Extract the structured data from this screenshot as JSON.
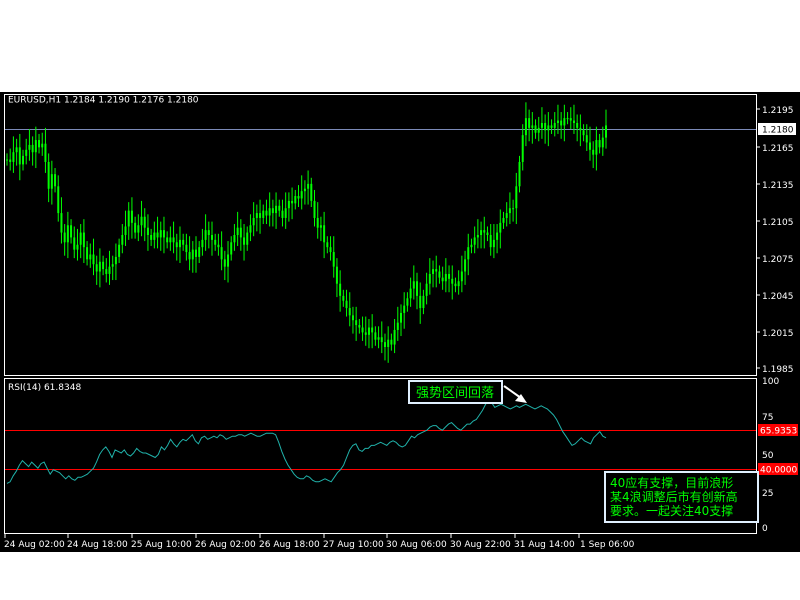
{
  "colors": {
    "background": "#000000",
    "candle": "#00ff00",
    "rsi_line": "#20b2aa",
    "level_line": "#ff0000",
    "price_line": "#7b8ab8",
    "text": "#ffffff",
    "note_text": "#00ff00",
    "note_border": "#e0f0ff"
  },
  "price_panel": {
    "header": "EURUSD,H1  1.2184 1.2190 1.2176 1.2180",
    "current_price": "1.2180",
    "y_ticks": [
      "1.2195",
      "1.2165",
      "1.2135",
      "1.2105",
      "1.2075",
      "1.2045",
      "1.2015",
      "1.1985"
    ]
  },
  "rsi_panel": {
    "header": "RSI(14)  61.8348",
    "y_ticks": [
      "100",
      "75",
      "50",
      "25",
      "0"
    ],
    "level_high": "65.9353",
    "level_low": "40.0000"
  },
  "x_axis": {
    "labels": [
      "24 Aug 02:00",
      "24 Aug 18:00",
      "25 Aug 10:00",
      "26 Aug 02:00",
      "26 Aug 18:00",
      "27 Aug 10:00",
      "30 Aug 06:00",
      "30 Aug 22:00",
      "31 Aug 14:00",
      "1 Sep 06:00"
    ]
  },
  "annotations": {
    "strong_zone": "强势区间回落",
    "note_line1": "40应有支撑，目前浪形",
    "note_line2": "某4浪调整后市有创新高",
    "note_line3": "要求。一起关注40支撑"
  },
  "chart_data": {
    "type": "line",
    "price_range": [
      1.1975,
      1.2205
    ],
    "close": [
      1.2152,
      1.215,
      1.2158,
      1.2162,
      1.2148,
      1.2155,
      1.216,
      1.2164,
      1.2158,
      1.2168,
      1.2162,
      1.2165,
      1.215,
      1.2128,
      1.214,
      1.213,
      1.2108,
      1.2092,
      1.2084,
      1.2098,
      1.2088,
      1.2078,
      1.2082,
      1.2092,
      1.208,
      1.207,
      1.2074,
      1.2066,
      1.206,
      1.2068,
      1.2062,
      1.2058,
      1.2064,
      1.2066,
      1.2072,
      1.2082,
      1.209,
      1.2097,
      1.211,
      1.21,
      1.2092,
      1.2098,
      1.2105,
      1.2096,
      1.209,
      1.2086,
      1.2092,
      1.2088,
      1.2094,
      1.2088,
      1.2084,
      1.2088,
      1.2084,
      1.208,
      1.2086,
      1.2082,
      1.2076,
      1.207,
      1.2078,
      1.2072,
      1.208,
      1.2086,
      1.2094,
      1.209,
      1.2086,
      1.2082,
      1.208,
      1.207,
      1.2064,
      1.2074,
      1.2084,
      1.209,
      1.2096,
      1.2088,
      1.2082,
      1.2092,
      1.2098,
      1.2104,
      1.2108,
      1.2104,
      1.211,
      1.2106,
      1.2112,
      1.2108,
      1.2114,
      1.211,
      1.2104,
      1.2112,
      1.2118,
      1.2116,
      1.2122,
      1.212,
      1.2126,
      1.2128,
      1.2132,
      1.2118,
      1.2104,
      1.2096,
      1.2098,
      1.2084,
      1.208,
      1.2076,
      1.2064,
      1.205,
      1.204,
      1.2036,
      1.203,
      1.2024,
      1.202,
      1.2016,
      1.2014,
      1.201,
      1.2008,
      1.2014,
      1.201,
      1.2004,
      1.2006,
      1.2002,
      1.1998,
      1.2004,
      1.2,
      1.2012,
      1.2018,
      1.2026,
      1.2032,
      1.2038,
      1.2046,
      1.2052,
      1.204,
      1.203,
      1.204,
      1.205,
      1.2058,
      1.2062,
      1.206,
      1.2055,
      1.2052,
      1.2058,
      1.2054,
      1.205,
      1.2048,
      1.2052,
      1.206,
      1.207,
      1.208,
      1.2082,
      1.2088,
      1.209,
      1.2094,
      1.2092,
      1.209,
      1.208,
      1.2086,
      1.2092,
      1.21,
      1.2104,
      1.2108,
      1.2112,
      1.2112,
      1.213,
      1.215,
      1.2172,
      1.2186,
      1.2178,
      1.218,
      1.2174,
      1.2178,
      1.2182,
      1.2176,
      1.218,
      1.2178,
      1.2182,
      1.2184,
      1.218,
      1.2186,
      1.2186,
      1.2184,
      1.2182,
      1.2178,
      1.2176,
      1.2172,
      1.2166,
      1.216,
      1.2156,
      1.2168,
      1.2162,
      1.217,
      1.218
    ],
    "rsi": [
      32,
      33,
      37,
      40,
      44,
      47,
      45,
      43,
      46,
      44,
      42,
      45,
      46,
      42,
      38,
      41,
      40,
      39,
      37,
      35,
      37,
      35,
      34,
      36,
      36,
      37,
      38,
      40,
      42,
      46,
      51,
      54,
      56,
      53,
      49,
      54,
      53,
      52,
      54,
      51,
      50,
      52,
      55,
      53,
      52,
      52,
      51,
      50,
      49,
      51,
      56,
      54,
      57,
      61,
      58,
      56,
      59,
      61,
      60,
      62,
      64,
      60,
      58,
      62,
      63,
      61,
      62,
      63,
      62,
      64,
      63,
      61,
      62,
      63,
      63,
      64,
      64,
      63,
      64,
      65,
      64,
      63,
      63,
      64,
      65,
      65,
      65,
      64,
      59,
      53,
      48,
      44,
      41,
      38,
      36,
      35,
      35,
      37,
      36,
      34,
      33,
      33,
      34,
      35,
      34,
      33,
      36,
      39,
      41,
      44,
      49,
      54,
      57,
      58,
      54,
      53,
      55,
      55,
      57,
      57,
      58,
      59,
      58,
      57,
      59,
      60,
      59,
      57,
      56,
      57,
      60,
      63,
      62,
      64,
      65,
      66,
      67,
      69,
      70,
      70,
      68,
      67,
      69,
      71,
      72,
      70,
      68,
      67,
      69,
      71,
      71,
      73,
      74,
      77,
      80,
      84,
      87,
      85,
      82,
      83,
      84,
      83,
      82,
      81,
      82,
      83,
      82,
      83,
      84,
      83,
      82,
      81,
      82,
      83,
      82,
      81,
      79,
      77,
      74,
      70,
      66,
      63,
      60,
      57,
      58,
      60,
      62,
      60,
      59,
      58,
      62,
      64,
      66,
      63,
      62
    ]
  }
}
